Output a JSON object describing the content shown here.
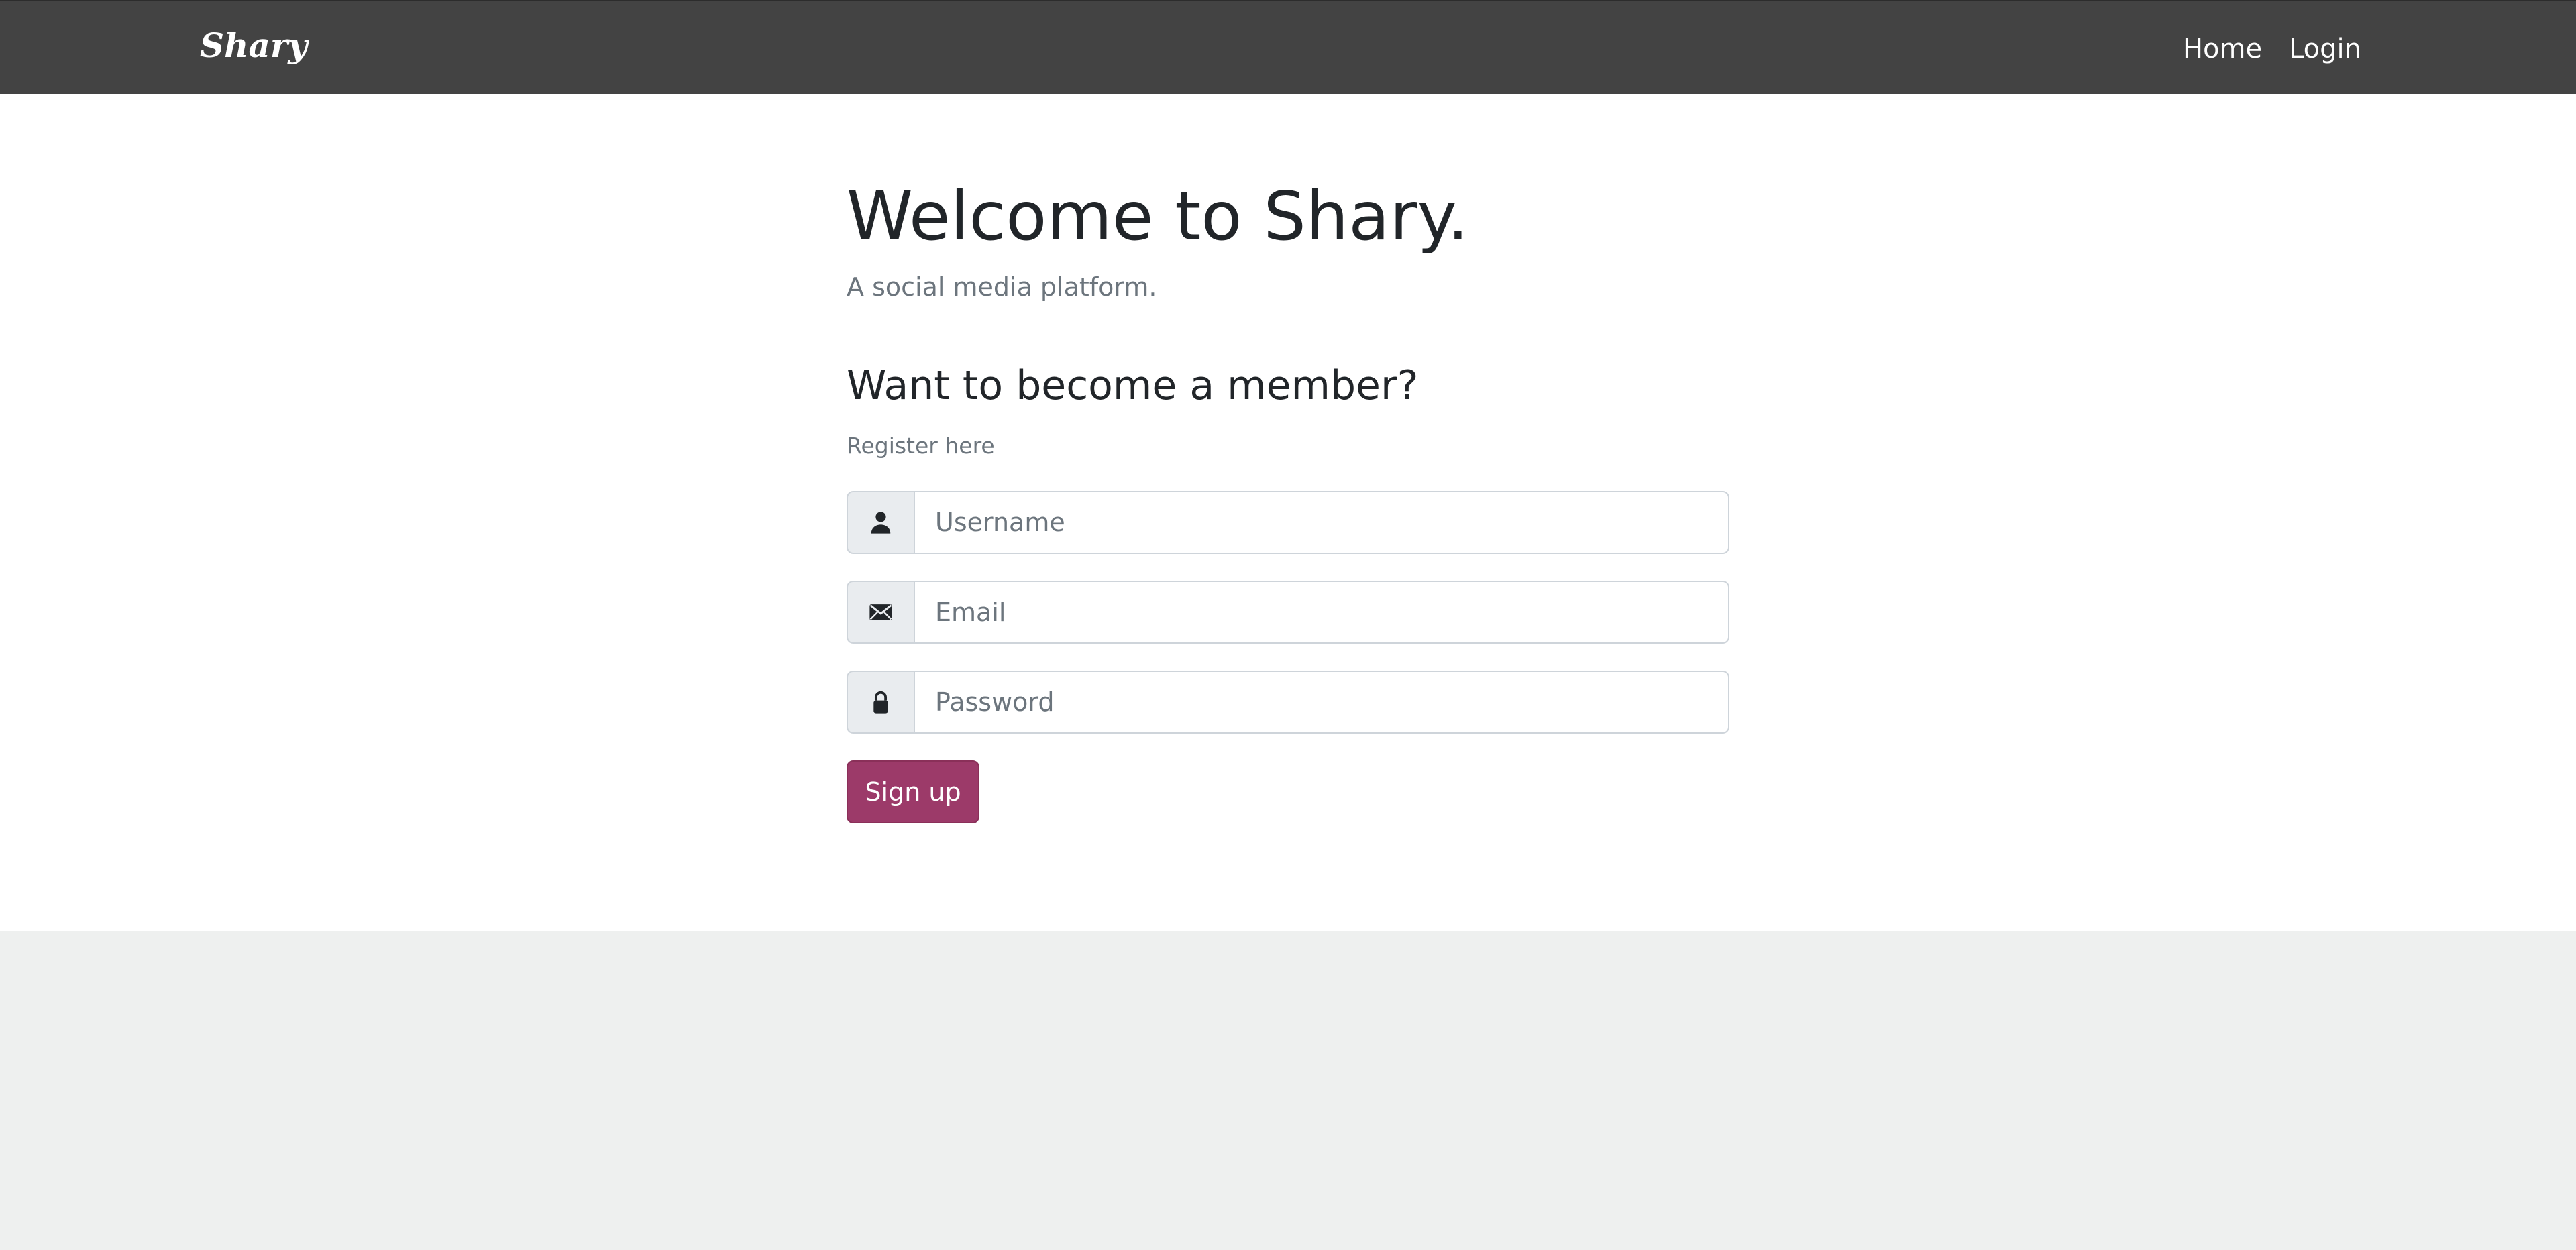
{
  "navbar": {
    "brand": "Shary",
    "links": [
      {
        "label": "Home"
      },
      {
        "label": "Login"
      }
    ]
  },
  "hero": {
    "title": "Welcome to Shary.",
    "subtitle": "A social media platform."
  },
  "register": {
    "heading": "Want to become a member?",
    "hint": "Register here",
    "fields": [
      {
        "icon": "user-icon",
        "placeholder": "Username",
        "value": ""
      },
      {
        "icon": "envelope-icon",
        "placeholder": "Email",
        "value": ""
      },
      {
        "icon": "lock-icon",
        "placeholder": "Password",
        "value": ""
      }
    ],
    "submit_label": "Sign up"
  },
  "colors": {
    "navbar_bg": "#434343",
    "accent": "#9c3a69",
    "page_bg": "#eef0ef"
  }
}
